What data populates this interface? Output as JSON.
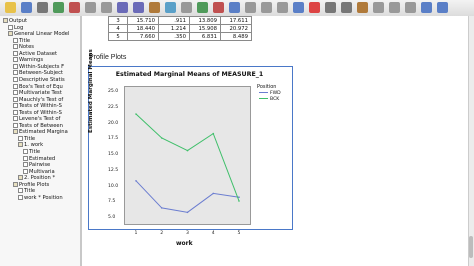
{
  "colors": {
    "series_fwd": "#6b7dd0",
    "series_bck": "#3fbf6a",
    "plot_bg": "#e7e7e7",
    "frame": "#4a78c8"
  },
  "toolbar": {
    "icons": [
      "open-icon",
      "save-icon",
      "print-icon",
      "export-icon",
      "recall-icon",
      "undo-icon",
      "redo-icon",
      "goto-data-icon",
      "goto-case-icon",
      "variables-icon",
      "find-icon",
      "insert-icon",
      "insert-table-icon",
      "show-all-icon",
      "designate-icon",
      "hide-icon",
      "expand-icon",
      "collapse-icon",
      "show-icon",
      "chart-icon",
      "text-icon",
      "title-icon",
      "pivot-icon",
      "insert-page-icon",
      "insert-output-icon",
      "select-icon",
      "promote-icon",
      "demote-icon"
    ]
  },
  "outline": {
    "items": [
      {
        "label": "Output",
        "depth": 0,
        "icon": "book"
      },
      {
        "label": "Log",
        "depth": 1,
        "icon": "doc"
      },
      {
        "label": "General Linear Model",
        "depth": 1,
        "icon": "book"
      },
      {
        "label": "Title",
        "depth": 2,
        "icon": "doc"
      },
      {
        "label": "Notes",
        "depth": 2,
        "icon": "doc"
      },
      {
        "label": "Active Dataset",
        "depth": 2,
        "icon": "doc"
      },
      {
        "label": "Warnings",
        "depth": 2,
        "icon": "doc"
      },
      {
        "label": "Within-Subjects F",
        "depth": 2,
        "icon": "doc"
      },
      {
        "label": "Between-Subject",
        "depth": 2,
        "icon": "doc"
      },
      {
        "label": "Descriptive Statis",
        "depth": 2,
        "icon": "doc"
      },
      {
        "label": "Box's Test of Equ",
        "depth": 2,
        "icon": "doc"
      },
      {
        "label": "Multivariate Test",
        "depth": 2,
        "icon": "doc"
      },
      {
        "label": "Mauchly's Test of",
        "depth": 2,
        "icon": "doc"
      },
      {
        "label": "Tests of Within-S",
        "depth": 2,
        "icon": "doc"
      },
      {
        "label": "Tests of Within-S",
        "depth": 2,
        "icon": "doc"
      },
      {
        "label": "Levene's Test of",
        "depth": 2,
        "icon": "doc"
      },
      {
        "label": "Tests of Between",
        "depth": 2,
        "icon": "doc"
      },
      {
        "label": "Estimated Margina",
        "depth": 2,
        "icon": "book"
      },
      {
        "label": "Title",
        "depth": 3,
        "icon": "doc"
      },
      {
        "label": "1. work",
        "depth": 3,
        "icon": "book"
      },
      {
        "label": "Title",
        "depth": 4,
        "icon": "doc"
      },
      {
        "label": "Estimated",
        "depth": 4,
        "icon": "doc"
      },
      {
        "label": "Pairwise",
        "depth": 4,
        "icon": "doc"
      },
      {
        "label": "Multivaria",
        "depth": 4,
        "icon": "doc"
      },
      {
        "label": "2. Position *",
        "depth": 3,
        "icon": "book"
      },
      {
        "label": "Profile Plots",
        "depth": 2,
        "icon": "book"
      },
      {
        "label": "Title",
        "depth": 3,
        "icon": "doc"
      },
      {
        "label": "work * Position",
        "depth": 3,
        "icon": "doc"
      }
    ]
  },
  "table": {
    "rows": [
      [
        "3",
        "15.710",
        ".911",
        "13.809",
        "17.611"
      ],
      [
        "4",
        "18.440",
        "1.214",
        "15.908",
        "20.972"
      ],
      [
        "5",
        "7.660",
        ".350",
        "6.831",
        "8.489"
      ]
    ]
  },
  "section_heading": "Profile Plots",
  "chart_data": {
    "type": "line",
    "title": "Estimated Marginal Means of MEASURE_1",
    "xlabel": "work",
    "ylabel": "Estimated Marginal Means",
    "x": [
      "1",
      "2",
      "3",
      "4",
      "5"
    ],
    "ylim": [
      5,
      25
    ],
    "yticks": [
      "25.0",
      "22.5",
      "20.0",
      "17.5",
      "15.0",
      "12.5",
      "10.0",
      "7.5",
      "5.0"
    ],
    "legend_title": "Position",
    "legend_placement": "right",
    "grid": false,
    "series": [
      {
        "name": "FWD",
        "values": [
          10.9,
          6.6,
          5.9,
          8.9,
          8.3
        ]
      },
      {
        "name": "BCK",
        "values": [
          21.5,
          17.7,
          15.7,
          18.4,
          7.7
        ]
      }
    ]
  }
}
